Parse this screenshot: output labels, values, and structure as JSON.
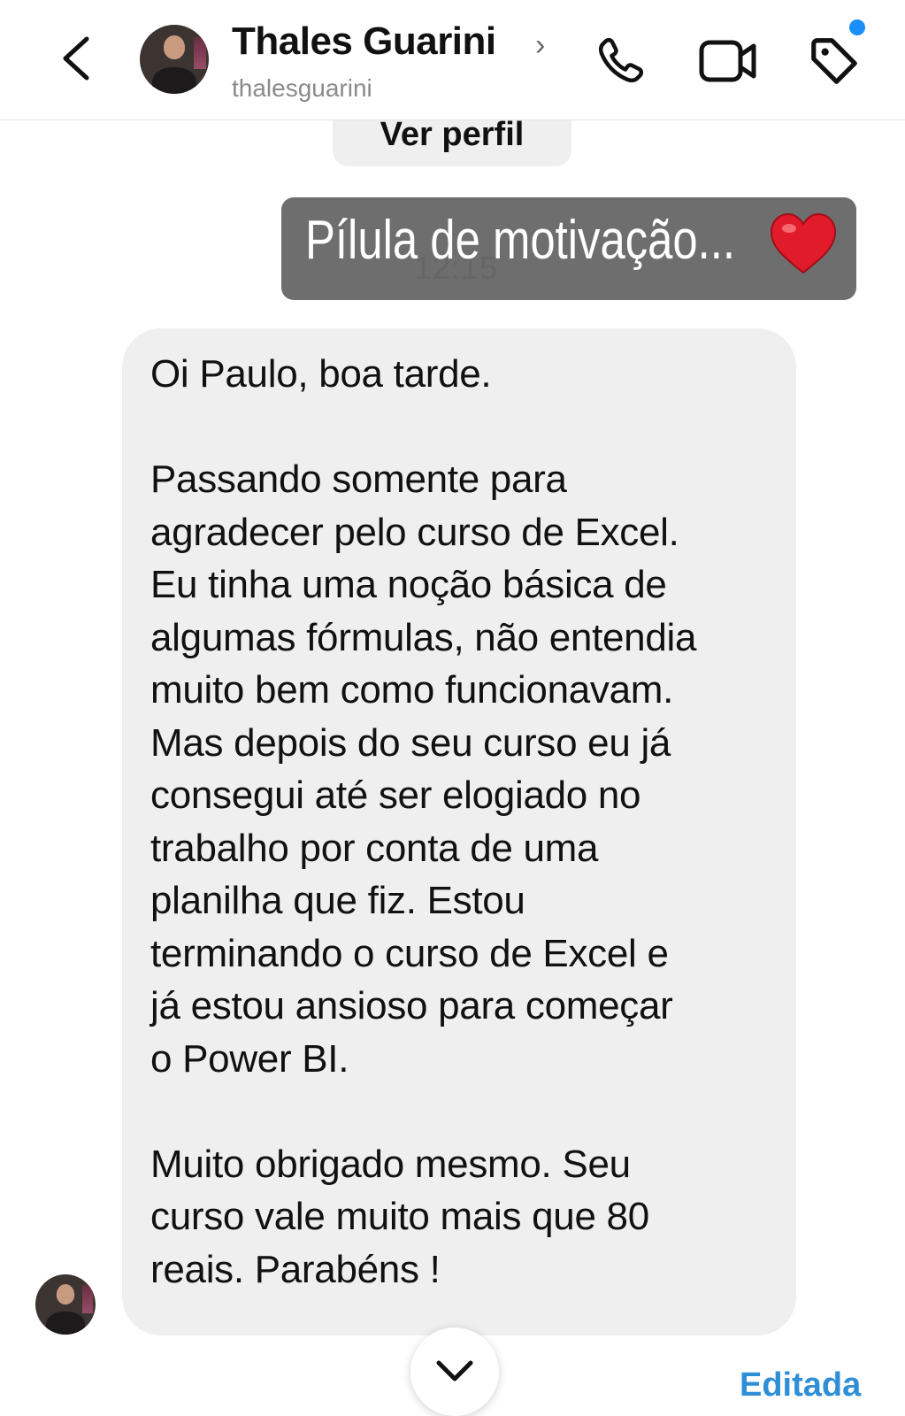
{
  "header": {
    "contact_name": "Thales Guarini",
    "username": "thalesguarini",
    "name_chevron": "›",
    "icons": [
      "back-arrow-icon",
      "phone-icon",
      "video-call-icon",
      "tag-icon"
    ],
    "notification_dot_color": "#1b8ef7"
  },
  "profile": {
    "view_profile_label": "Ver perfil"
  },
  "sent_message": {
    "text": "Pílula de motivação...",
    "emoji": "heart",
    "time": "12:15",
    "background": "#6e6e6e"
  },
  "received_message": {
    "text": "Oi Paulo, boa tarde.\n\nPassando somente para\nagradecer pelo curso de Excel.\nEu tinha uma noção básica de\nalgumas fórmulas, não entendia\nmuito bem como funcionavam.\nMas depois do seu curso eu já\nconsegui até ser elogiado no\ntrabalho por conta de uma\nplanilha que fiz. Estou\nterminando o curso de Excel e\njá estou ansioso para começar\no Power BI.\n\nMuito obrigado mesmo. Seu\ncurso vale muito mais que 80\nreais. Parabéns !",
    "status": "Editada"
  },
  "colors": {
    "accent": "#2f8fd6",
    "bubble": "#efefef"
  }
}
